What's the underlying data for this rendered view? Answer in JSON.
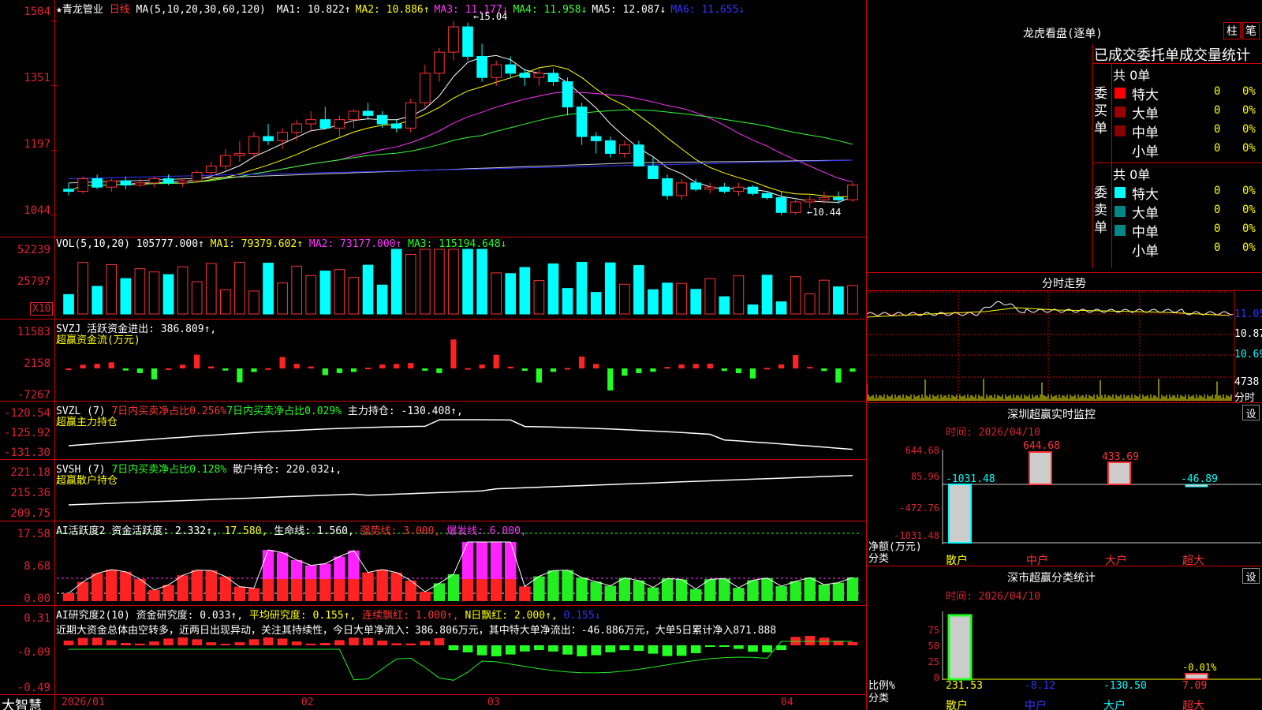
{
  "header": {
    "stock_name": "★青龙管业",
    "period": "日线",
    "ma_label": "MA(5,10,20,30,60,120)",
    "ma": [
      {
        "label": "MA1: 10.822",
        "arrow": "↑",
        "color": "#ffffff"
      },
      {
        "label": "MA2: 10.886",
        "arrow": "↑",
        "color": "#ffff00"
      },
      {
        "label": "MA3: 11.177",
        "arrow": "↓",
        "color": "#ff33ff"
      },
      {
        "label": "MA4: 11.958",
        "arrow": "↓",
        "color": "#33ff33"
      },
      {
        "label": "MA5: 12.087",
        "arrow": "↓",
        "color": "#ffffff"
      },
      {
        "label": "MA6: 11.655",
        "arrow": "↓",
        "color": "#3333ff"
      }
    ]
  },
  "main": {
    "yticks": [
      "1504",
      "1351",
      "1197",
      "1044"
    ],
    "high_label": "15.04",
    "low_label": "10.44"
  },
  "vol": {
    "legend": "VOL(5,10,20)",
    "value": "105777.000↑",
    "ma1": "MA1: 79379.602↑",
    "ma2": "MA2: 73177.000↑",
    "ma3": "MA3: 115194.648↓",
    "yticks": [
      "52239",
      "25797"
    ],
    "unit": "X10"
  },
  "svzj": {
    "legend": "SVZJ  活跃资金进出: 386.809↑,",
    "subtitle": "超赢资金流(万元)",
    "yticks": [
      "11583",
      "2158",
      "-7267"
    ]
  },
  "svzl": {
    "legend_a": "SVZL (7)",
    "legend_b": "7日内买卖净占比0.256%",
    "legend_c": "7日内买卖净占比0.029%",
    "legend_d": "主力持仓: -130.408↑,",
    "subtitle": "超赢主力持仓",
    "yticks": [
      "-120.54",
      "-125.92",
      "-131.30"
    ]
  },
  "svsh": {
    "legend_a": "SVSH (7)",
    "legend_b": "7日内买卖净占比0.128%",
    "legend_c": "散户持仓: 220.032↓,",
    "subtitle": "超赢散户持仓",
    "yticks": [
      "221.18",
      "215.36",
      "209.75"
    ]
  },
  "ai1": {
    "legend_a": "AI活跃度2 资金活跃度: 2.332↑,",
    "legend_b": "17.580,",
    "legend_c": "生命线: 1.560,",
    "legend_d": "强势线: 3.000,",
    "legend_e": "爆发线: 6.000,",
    "yticks": [
      "17.58",
      "8.68",
      "0.00"
    ]
  },
  "ai2": {
    "legend_a": "AI研究度2(10) 资金研究度: 0.033↑,",
    "legend_b": "平均研究度: 0.155↑,",
    "legend_c": "连续飘红: 1.000↑,",
    "legend_d": "N日飘红: 2.000↑,",
    "legend_e": "0.155↓",
    "note": "近期大资金总体由空转多，近两日出现异动，关注其持续性，今日大单净流入：386.806万元，其中特大单净流出：-46.886万元，大单5日累计净入871.888",
    "yticks": [
      "0.31",
      "-0.09",
      "-0.49"
    ]
  },
  "xaxis": {
    "labels": [
      "2026/01",
      "02",
      "03",
      "04"
    ],
    "app": "大智慧"
  },
  "dragon": {
    "title": "龙虎看盘(逐单)",
    "btn1": "柱",
    "btn2": "笔",
    "subtitle": "已成交委托单成交量统计",
    "buy": {
      "side": "委买单",
      "total": "共 0单",
      "rows": [
        {
          "name": "特大",
          "n": "0",
          "pct": "0%",
          "color": "#ff0000"
        },
        {
          "name": "大单",
          "n": "0",
          "pct": "0%",
          "color": "#990000"
        },
        {
          "name": "中单",
          "n": "0",
          "pct": "0%",
          "color": "#880000"
        },
        {
          "name": "小单",
          "n": "0",
          "pct": "0%",
          "color": ""
        }
      ]
    },
    "sell": {
      "side": "委卖单",
      "total": "共 0单",
      "rows": [
        {
          "name": "特大",
          "n": "0",
          "pct": "0%",
          "color": "#00ffff"
        },
        {
          "name": "大单",
          "n": "0",
          "pct": "0%",
          "color": "#008888"
        },
        {
          "name": "中单",
          "n": "0",
          "pct": "0%",
          "color": "#008888"
        },
        {
          "name": "小单",
          "n": "0",
          "pct": "0%",
          "color": ""
        }
      ]
    }
  },
  "intraday": {
    "title": "分时走势",
    "prices": [
      "11.05",
      "10.87",
      "10.69"
    ],
    "vol": "4738",
    "unit": "分时"
  },
  "sz_monitor": {
    "title": "深圳超赢实时监控",
    "btn": "设",
    "time": "时间: 2026/04/10",
    "yticks": [
      "644.68",
      "85.96",
      "-472.76",
      "-1031.48"
    ],
    "ylabel1": "净额(万元)",
    "ylabel2": "分类",
    "cats": [
      "散户",
      "中户",
      "大户",
      "超大"
    ],
    "values": [
      "-1031.48",
      "644.68",
      "433.69",
      "-46.89"
    ]
  },
  "sz_class": {
    "title": "深市超赢分类统计",
    "btn": "设",
    "time": "时间: 2026/04/10",
    "yticks": [
      "75",
      "50",
      "25",
      "0"
    ],
    "ylabel1": "比例%",
    "ylabel2": "分类",
    "cats": [
      "散户",
      "中户",
      "大户",
      "超大"
    ],
    "values": [
      "231.53",
      "-8.12",
      "-130.50",
      "7.09"
    ],
    "top_label": "-0.01%"
  },
  "chart_data": {
    "type": "candlestick",
    "title": "青龙管业 日线",
    "ohlc": [
      [
        11.05,
        11.2,
        10.9,
        11.0
      ],
      [
        11.0,
        11.35,
        10.95,
        11.3
      ],
      [
        11.3,
        11.4,
        11.05,
        11.1
      ],
      [
        11.1,
        11.3,
        11.0,
        11.25
      ],
      [
        11.25,
        11.35,
        11.05,
        11.15
      ],
      [
        11.15,
        11.3,
        11.1,
        11.2
      ],
      [
        11.2,
        11.35,
        11.1,
        11.3
      ],
      [
        11.3,
        11.4,
        11.15,
        11.2
      ],
      [
        11.2,
        11.3,
        11.1,
        11.25
      ],
      [
        11.25,
        11.5,
        11.2,
        11.45
      ],
      [
        11.45,
        11.7,
        11.35,
        11.6
      ],
      [
        11.6,
        12.0,
        11.5,
        11.85
      ],
      [
        11.85,
        12.2,
        11.7,
        11.9
      ],
      [
        11.9,
        12.4,
        11.8,
        12.3
      ],
      [
        12.3,
        12.6,
        12.1,
        12.2
      ],
      [
        12.2,
        12.5,
        12.0,
        12.4
      ],
      [
        12.4,
        12.7,
        12.2,
        12.6
      ],
      [
        12.6,
        12.9,
        12.4,
        12.7
      ],
      [
        12.7,
        13.0,
        12.5,
        12.5
      ],
      [
        12.5,
        12.8,
        12.3,
        12.7
      ],
      [
        12.7,
        12.95,
        12.5,
        12.9
      ],
      [
        12.9,
        13.1,
        12.7,
        12.8
      ],
      [
        12.8,
        12.9,
        12.5,
        12.6
      ],
      [
        12.6,
        12.7,
        12.4,
        12.5
      ],
      [
        12.5,
        13.2,
        12.4,
        13.1
      ],
      [
        13.1,
        14.0,
        13.0,
        13.8
      ],
      [
        13.8,
        14.4,
        13.6,
        14.3
      ],
      [
        14.3,
        15.04,
        14.1,
        14.9
      ],
      [
        14.9,
        15.0,
        14.1,
        14.2
      ],
      [
        14.2,
        14.5,
        13.6,
        13.7
      ],
      [
        13.7,
        14.1,
        13.5,
        14.0
      ],
      [
        14.0,
        14.2,
        13.7,
        13.8
      ],
      [
        13.8,
        13.9,
        13.5,
        13.7
      ],
      [
        13.7,
        13.9,
        13.5,
        13.8
      ],
      [
        13.8,
        13.9,
        13.5,
        13.6
      ],
      [
        13.6,
        13.7,
        12.8,
        13.0
      ],
      [
        13.0,
        13.1,
        12.1,
        12.3
      ],
      [
        12.3,
        12.4,
        11.9,
        12.2
      ],
      [
        12.2,
        12.3,
        11.8,
        11.9
      ],
      [
        11.9,
        12.2,
        11.8,
        12.1
      ],
      [
        12.1,
        12.2,
        11.6,
        11.6
      ],
      [
        11.6,
        11.8,
        11.3,
        11.3
      ],
      [
        11.3,
        11.4,
        10.8,
        10.9
      ],
      [
        10.9,
        11.3,
        10.8,
        11.2
      ],
      [
        11.2,
        11.3,
        11.0,
        11.05
      ],
      [
        11.05,
        11.2,
        10.95,
        11.1
      ],
      [
        11.1,
        11.2,
        10.95,
        11.0
      ],
      [
        11.0,
        11.2,
        10.9,
        11.1
      ],
      [
        11.1,
        11.15,
        10.9,
        10.95
      ],
      [
        10.95,
        11.0,
        10.8,
        10.85
      ],
      [
        10.85,
        11.0,
        10.44,
        10.5
      ],
      [
        10.5,
        10.8,
        10.45,
        10.75
      ],
      [
        10.75,
        10.9,
        10.6,
        10.8
      ],
      [
        10.8,
        11.0,
        10.7,
        10.85
      ],
      [
        10.85,
        11.0,
        10.7,
        10.8
      ],
      [
        10.8,
        11.2,
        10.75,
        11.15
      ]
    ],
    "ylim": [
      10.3,
      15.2
    ]
  }
}
